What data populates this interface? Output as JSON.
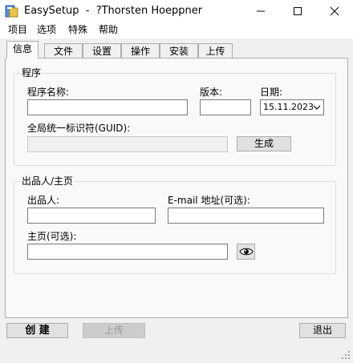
{
  "window": {
    "title": "EasySetup  -  ?Thorsten Hoeppner"
  },
  "menu": [
    "项目",
    "选项",
    "特殊",
    "帮助"
  ],
  "tabs": [
    "信息",
    "文件",
    "设置",
    "操作",
    "安装",
    "上传"
  ],
  "program_group": {
    "legend": "程序",
    "name_label": "程序名称:",
    "name_value": "",
    "version_label": "版本:",
    "version_value": "",
    "date_label": "日期:",
    "date_value": "15.11.2023",
    "guid_label": "全局统一标识符(GUID):",
    "guid_value": "",
    "generate_button": "生成"
  },
  "publisher_group": {
    "legend": "出品人/主页",
    "publisher_label": "出品人:",
    "publisher_value": "",
    "email_label": "E-mail 地址(可选):",
    "email_value": "",
    "homepage_label": "主页(可选):",
    "homepage_value": ""
  },
  "footer": {
    "create_button": "创 建",
    "upload_button": "上传",
    "exit_button": "退出"
  },
  "icons": {
    "app": "app-icon",
    "preview": "eye-icon",
    "minimize": "minimize-icon",
    "maximize": "maximize-icon",
    "close": "close-icon"
  }
}
